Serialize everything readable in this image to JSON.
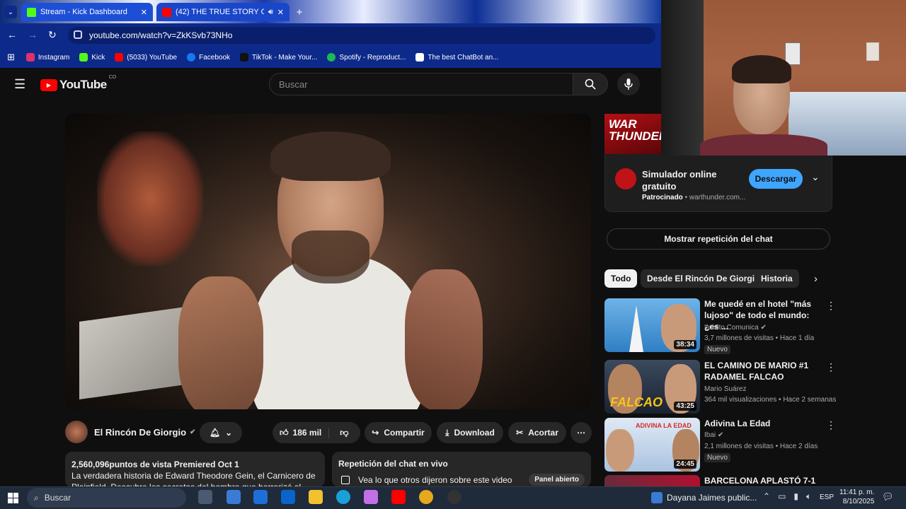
{
  "browser": {
    "tabs": [
      {
        "title": "Stream - Kick Dashboard",
        "active": false
      },
      {
        "title": "(42) THE TRUE STORY OF E",
        "active": true
      }
    ],
    "url": "youtube.com/watch?v=ZkKSvb73NHo",
    "bookmarks": [
      {
        "label": "Instagram",
        "icon": "instagram-icon",
        "color": "#e1306c"
      },
      {
        "label": "Kick",
        "icon": "kick-icon",
        "color": "#53fc18"
      },
      {
        "label": "(5033) YouTube",
        "icon": "youtube-icon",
        "color": "#ff0000"
      },
      {
        "label": "Facebook",
        "icon": "facebook-icon",
        "color": "#1877f2"
      },
      {
        "label": "TikTok - Make Your...",
        "icon": "tiktok-icon",
        "color": "#111111"
      },
      {
        "label": "Spotify - Reproduct...",
        "icon": "spotify-icon",
        "color": "#1db954"
      },
      {
        "label": "The best ChatBot an...",
        "icon": "chatbot-icon",
        "color": "#ffffff"
      }
    ]
  },
  "youtube": {
    "logo_text": "YouTube",
    "country": "CO",
    "search_placeholder": "Buscar",
    "channel": {
      "name": "El Rincón De Giorgio"
    },
    "actions": {
      "likes": "186 mil",
      "share": "Compartir",
      "download": "Download",
      "clip": "Acortar"
    },
    "description": {
      "stats": "2,560,096puntos de vista  Premiered Oct 1",
      "text": "La verdadera historia de Edward Theodore Gein, el Carnicero de Plainfield. Descubre los secretos del hombre que horrorizó al ...más"
    },
    "chat_replay": {
      "title": "Repetición del chat en vivo",
      "text": "Vea lo que otros dijeron sobre este video",
      "button": "Panel abierto"
    },
    "ad": {
      "thumb_text": "WAR THUNDER",
      "title": "Simulador online gratuito",
      "sponsor": "Patrocinado",
      "domain": "warthunder.com...",
      "cta": "Descargar"
    },
    "show_chat_replay": "Mostrar repetición del chat",
    "chips": [
      "Todo",
      "Desde El Rincón De Giorgio",
      "Historia"
    ],
    "recommendations": [
      {
        "title": "Me quedé en el hotel \"más lujoso\" de todo el mundo: ¿es ...",
        "channel": "Luisito Comunica",
        "meta": "3,7 millones de visitas • Hace 1 día",
        "badge": "Nuevo",
        "duration": "38:34"
      },
      {
        "title": "EL CAMINO DE MARIO #1 RADAMEL FALCAO",
        "channel": "Mario Suárez",
        "meta": "364 mil visualizaciones • Hace 2 semanas",
        "badge": "",
        "duration": "43:25"
      },
      {
        "title": "Adivina La Edad",
        "channel": "Ibai",
        "meta": "2,1 millones de visitas • Hace 2 días",
        "badge": "Nuevo",
        "duration": "24:45"
      },
      {
        "title": "BARCELONA APLASTÓ 7-1 al",
        "channel": "",
        "meta": "",
        "badge": "",
        "duration": ""
      }
    ]
  },
  "taskbar": {
    "search": "Buscar",
    "notification": "Dayana Jaimes public...",
    "lang": "ESP",
    "time": "11:41 p. m.",
    "date": "8/10/2025"
  },
  "colors": {
    "accent_blue": "#3ea6ff",
    "yt_red": "#ff0000",
    "bg": "#0f0f0f"
  }
}
